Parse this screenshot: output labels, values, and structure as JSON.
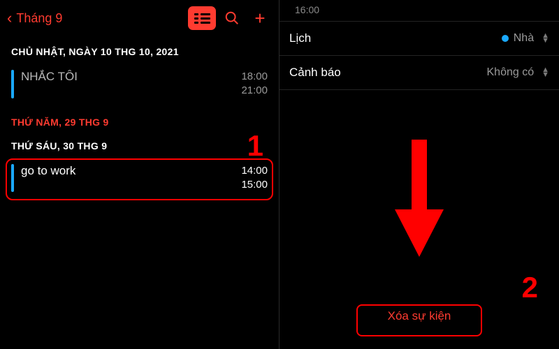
{
  "left": {
    "back_label": "Tháng 9",
    "date_sunday": "CHỦ NHẬT, NGÀY 10 THG 10, 2021",
    "event1_title": "NHẮC TÔI",
    "event1_start": "18:00",
    "event1_end": "21:00",
    "date_thu": "THỨ NĂM, 29 THG 9",
    "date_fri": "THỨ SÁU, 30 THG 9",
    "event2_title": "go to work",
    "event2_start": "14:00",
    "event2_end": "15:00",
    "annot1": "1"
  },
  "right": {
    "time_stub": "16:00",
    "cal_label": "Lịch",
    "cal_value": "Nhà",
    "alert_label": "Cảnh báo",
    "alert_value": "Không có",
    "delete_label": "Xóa sự kiện",
    "annot2": "2"
  }
}
